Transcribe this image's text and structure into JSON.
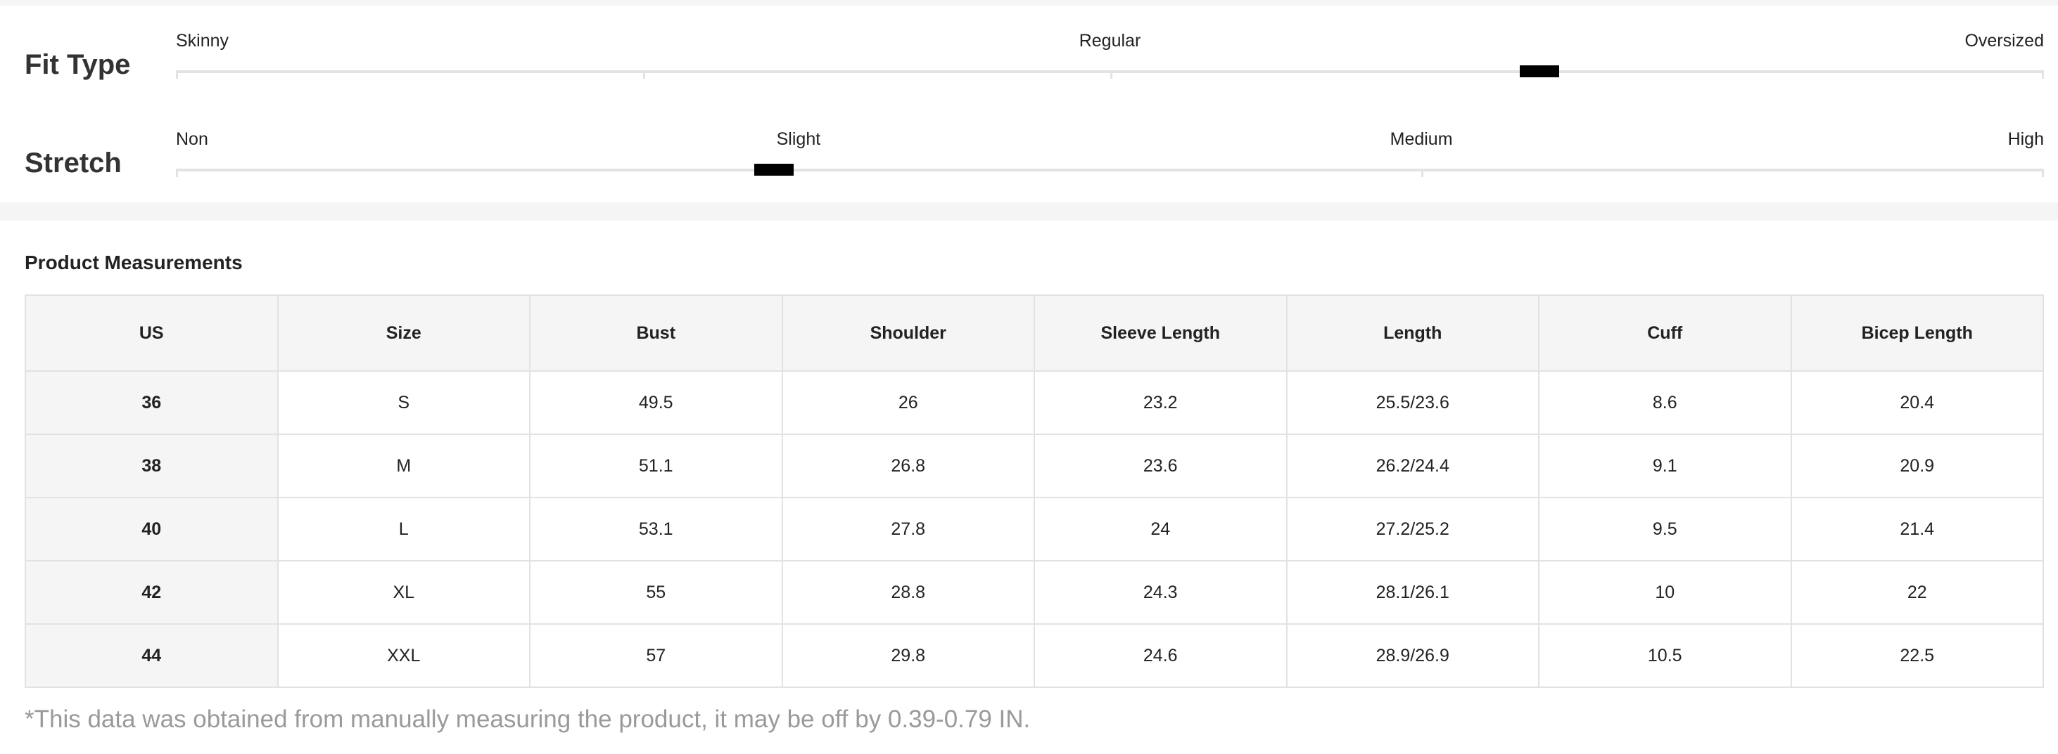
{
  "fit_scales": [
    {
      "title": "Fit Type",
      "labels": [
        "Skinny",
        "Regular",
        "Oversized"
      ],
      "value": 0.73
    },
    {
      "title": "Stretch",
      "labels": [
        "Non",
        "Slight",
        "Medium",
        "High"
      ],
      "value": 0.32
    }
  ],
  "measurements": {
    "title": "Product Measurements",
    "headers": [
      "US",
      "Size",
      "Bust",
      "Shoulder",
      "Sleeve Length",
      "Length",
      "Cuff",
      "Bicep Length"
    ],
    "rows": [
      [
        "36",
        "S",
        "49.5",
        "26",
        "23.2",
        "25.5/23.6",
        "8.6",
        "20.4"
      ],
      [
        "38",
        "M",
        "51.1",
        "26.8",
        "23.6",
        "26.2/24.4",
        "9.1",
        "20.9"
      ],
      [
        "40",
        "L",
        "53.1",
        "27.8",
        "24",
        "27.2/25.2",
        "9.5",
        "21.4"
      ],
      [
        "42",
        "XL",
        "55",
        "28.8",
        "24.3",
        "28.1/26.1",
        "10",
        "22"
      ],
      [
        "44",
        "XXL",
        "57",
        "29.8",
        "24.6",
        "28.9/26.9",
        "10.5",
        "22.5"
      ]
    ],
    "footnote": "*This data was obtained from manually measuring the product, it may be off by 0.39-0.79 IN."
  }
}
